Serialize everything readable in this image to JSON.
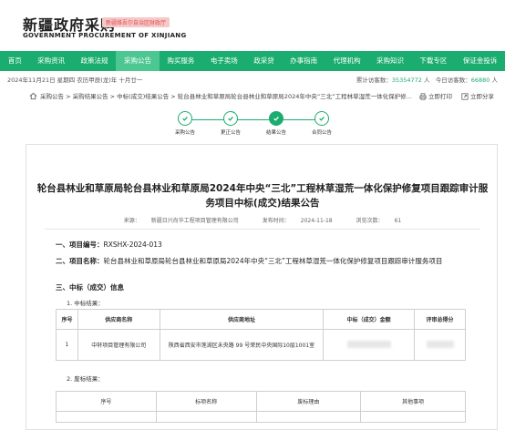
{
  "site": {
    "title_cn": "新疆政府采购",
    "title_en": "GOVERNMENT PROCUREMENT OF XINJIANG",
    "tag": "新疆维吾尔自治区财政厅"
  },
  "nav": [
    {
      "label": "首页"
    },
    {
      "label": "采购资讯"
    },
    {
      "label": "政策法规"
    },
    {
      "label": "采购公告",
      "active": true
    },
    {
      "label": "购买服务"
    },
    {
      "label": "电子卖场"
    },
    {
      "label": "政采贷"
    },
    {
      "label": "办事指南"
    },
    {
      "label": "代理机构"
    },
    {
      "label": "采购知识"
    },
    {
      "label": "下载专区"
    },
    {
      "label": "保证金投诉"
    }
  ],
  "infobar": {
    "date": "2024年11月21日 星期四 农历甲辰(龙)年 十月廿一",
    "total_label": "累计访客数：",
    "total_value": "35354772",
    "total_unit": "人",
    "today_label": "今日访客数：",
    "today_value": "66880",
    "today_unit": "人"
  },
  "breadcrumb": {
    "text": "采购公告 > 采购结果公告 > 中标(成交)结果公告 > 轮台县林业和草原局轮台县林业和草原局2024年中央“三北”工程林草湿荒一体化保护修...",
    "print": "立即打印",
    "share": "立即分享"
  },
  "steps": [
    {
      "label": "采购公告"
    },
    {
      "label": "更正公告"
    },
    {
      "label": "结果公告",
      "current": true
    },
    {
      "label": "合同公告"
    }
  ],
  "doc": {
    "title": "轮台县林业和草原局轮台县林业和草原局2024年中央“三北”工程林草湿荒一体化保护修复项目跟踪审计服务项目中标(成交)结果公告",
    "source_label": "来源：",
    "source": "新疆日兴尚华工程项目管理有限公司",
    "date_label": "发布时间：",
    "date": "2024-11-18",
    "views_label": "浏览次数：",
    "views": "61",
    "sec1_label": "一、项目编号：",
    "sec1_value": "RXSHX-2024-013",
    "sec2_label": "二、项目名称：",
    "sec2_value": "轮台县林业和草原局轮台县林业和草原局2024年中央“三北”工程林草湿荒一体化保护修复项目跟踪审计服务项目",
    "sec3_label": "三、中标（成交）信息",
    "sub1": "1. 中标结果：",
    "table1_headers": [
      "序号",
      "供应商名称",
      "供应商地址",
      "中标（成交）金额",
      "评审总得分"
    ],
    "table1_row": [
      "1",
      "中轩项目管理有限公司",
      "陕西省西安市莲湖区未央路 99 号荣民中央国际10层1001室"
    ],
    "sub2": "2. 废标结果：",
    "table2_headers": [
      "序号",
      "标项名称",
      "废标理由",
      "其他事项"
    ]
  }
}
